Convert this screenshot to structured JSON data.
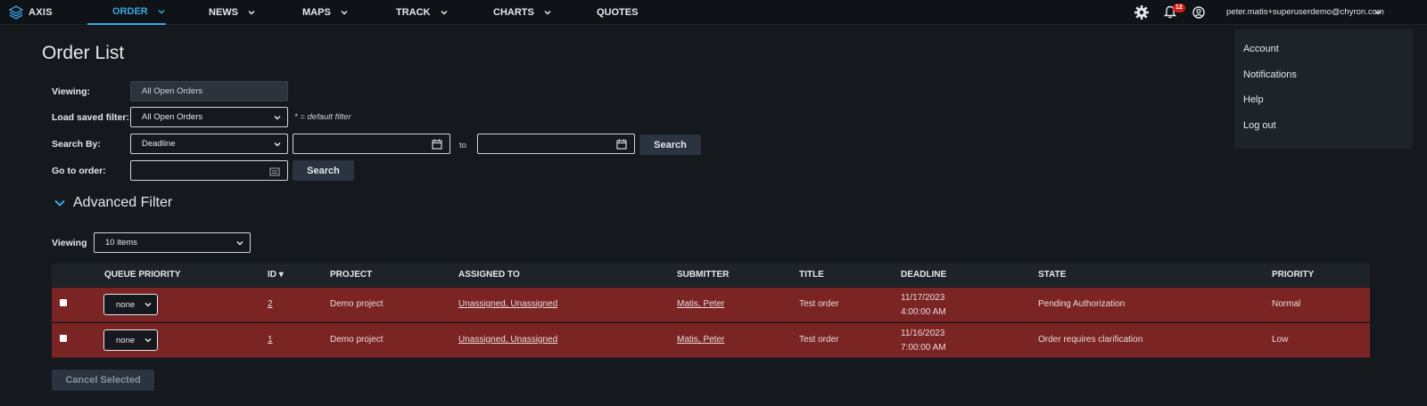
{
  "app": {
    "brand": "AXIS"
  },
  "nav": [
    {
      "label": "ORDER",
      "active": true,
      "has_menu": true
    },
    {
      "label": "NEWS",
      "has_menu": true
    },
    {
      "label": "MAPS",
      "has_menu": true
    },
    {
      "label": "TRACK",
      "has_menu": true
    },
    {
      "label": "CHARTS",
      "has_menu": true
    },
    {
      "label": "QUOTES",
      "has_menu": false
    }
  ],
  "header": {
    "settings_icon": "gear-icon",
    "notifications_icon": "bell-icon",
    "notification_count": "12",
    "user_icon": "user-circle-icon",
    "user_email": "peter.matis+superuserdemo@chyron.com"
  },
  "user_menu": {
    "items": [
      "Account",
      "Notifications",
      "Help",
      "Log out"
    ]
  },
  "page": {
    "title": "Order List"
  },
  "filters": {
    "viewing_label": "Viewing:",
    "viewing_value": "All Open Orders",
    "saved_filter_label": "Load saved filter:",
    "saved_filter_value": "All Open Orders",
    "default_hint": "* = default filter",
    "search_by_label": "Search By:",
    "search_by_value": "Deadline",
    "from_date": "",
    "to_label": "to",
    "to_date": "",
    "search_button": "Search",
    "goto_label": "Go to order:",
    "goto_value": "",
    "goto_button": "Search"
  },
  "advanced_filter": {
    "label": "Advanced Filter"
  },
  "list": {
    "viewing_label": "Viewing",
    "page_size": "10 items"
  },
  "table": {
    "headers": {
      "queue_priority": "QUEUE PRIORITY",
      "id": "ID",
      "project": "PROJECT",
      "assigned_to": "ASSIGNED TO",
      "submitter": "SUBMITTER",
      "title": "TITLE",
      "deadline": "DEADLINE",
      "state": "STATE",
      "priority": "PRIORITY"
    },
    "sort_indicator": "▾",
    "rows": [
      {
        "queue_priority": "none",
        "id": "2",
        "project": "Demo project",
        "assigned_to": "Unassigned, Unassigned",
        "submitter": "Matis, Peter",
        "title": "Test order",
        "deadline_date": "11/17/2023",
        "deadline_time": "4:00:00 AM",
        "state": "Pending Authorization",
        "priority": "Normal"
      },
      {
        "queue_priority": "none",
        "id": "1",
        "project": "Demo project",
        "assigned_to": "Unassigned, Unassigned",
        "submitter": "Matis, Peter",
        "title": "Test order",
        "deadline_date": "11/16/2023",
        "deadline_time": "7:00:00 AM",
        "state": "Order requires clarification",
        "priority": "Low"
      }
    ]
  },
  "actions": {
    "cancel_selected": "Cancel Selected"
  },
  "colors": {
    "background": "#15181d",
    "accent": "#3aa7e0",
    "row_highlight": "#7a2424",
    "badge": "#d51c1c"
  }
}
